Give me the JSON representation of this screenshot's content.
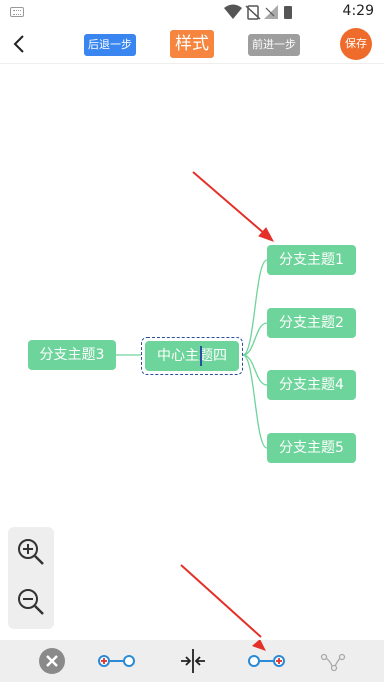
{
  "status_bar": {
    "time": "4:29",
    "icons": [
      "keyboard-icon",
      "wifi-icon",
      "no-sim-icon",
      "signal-icon",
      "battery-icon"
    ]
  },
  "toolbar": {
    "undo_label": "后退一步",
    "style_label": "样式",
    "redo_label": "前进一步",
    "save_label": "保存"
  },
  "mindmap": {
    "center": "中心主题四",
    "left_branch": "分支主题3",
    "right_branches": [
      "分支主题1",
      "分支主题2",
      "分支主题4",
      "分支主题5"
    ]
  },
  "colors": {
    "node": "#6dd49b",
    "undo": "#3a86f0",
    "style": "#f5853f",
    "save": "#ef6b2b",
    "arrow": "#e3312a",
    "selection": "#2a4fa0"
  }
}
